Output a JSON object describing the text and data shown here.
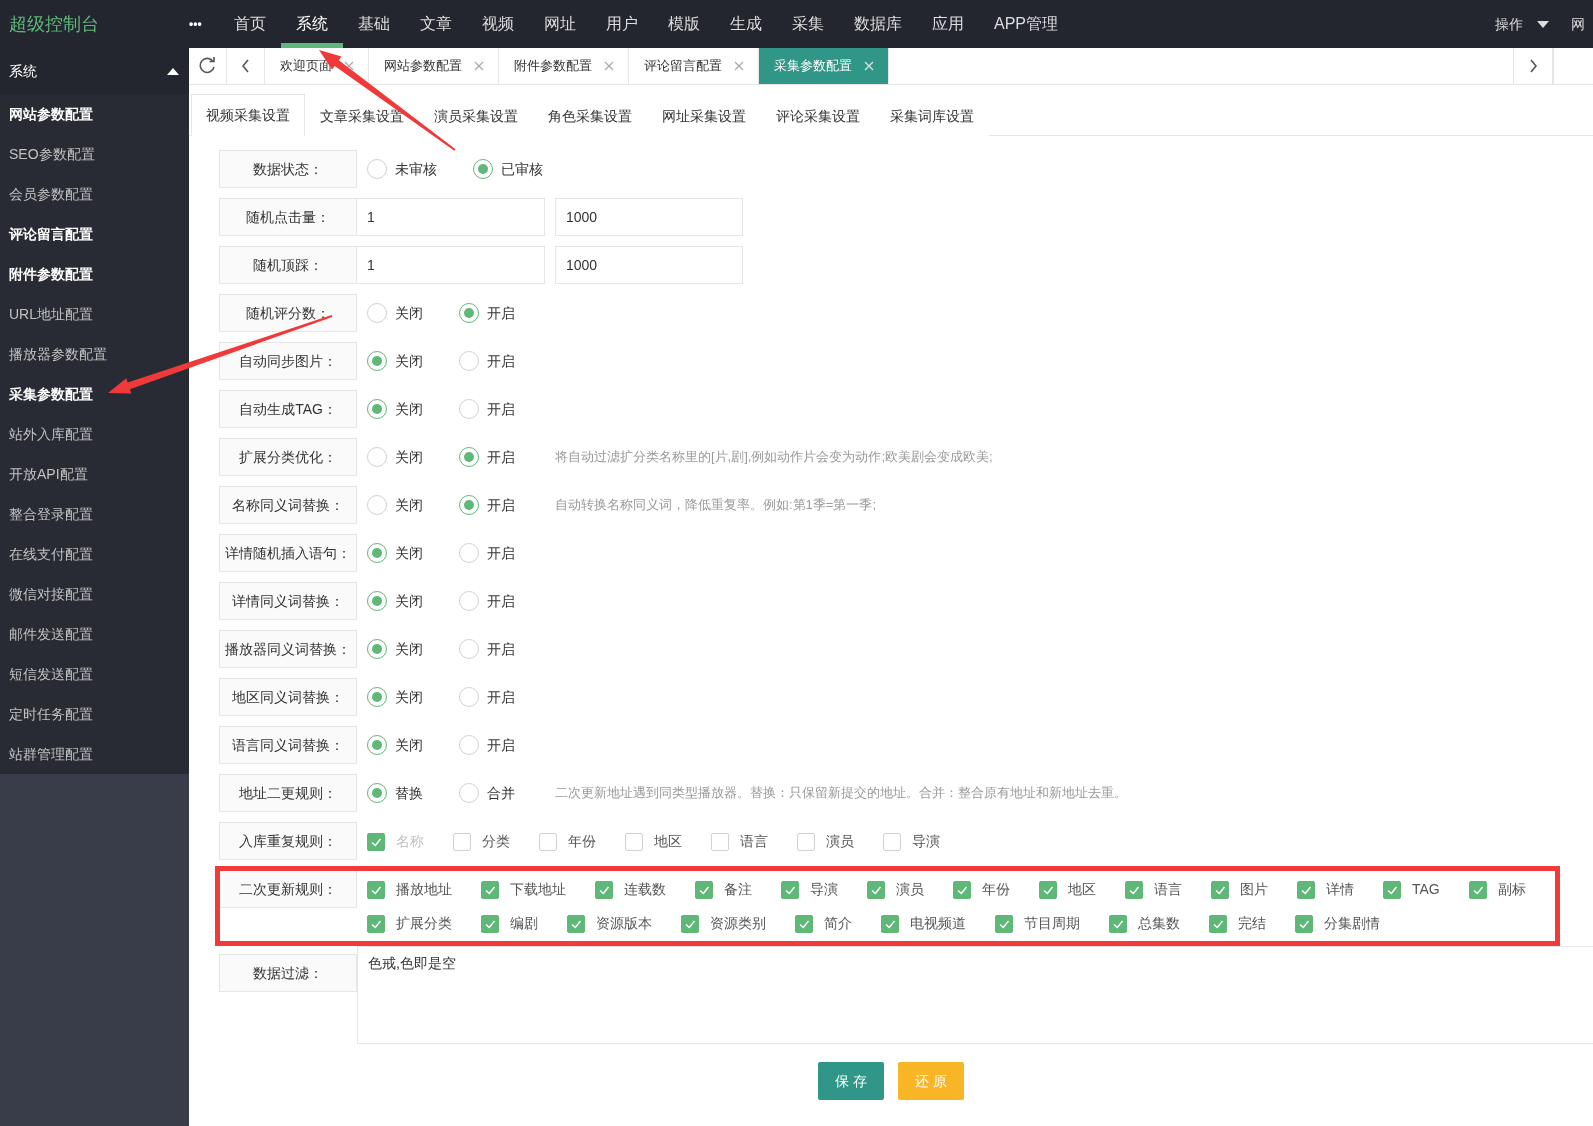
{
  "brand": "超级控制台",
  "more": "•••",
  "nav": [
    {
      "label": "首页",
      "selected": false,
      "pointed": false
    },
    {
      "label": "系统",
      "selected": true,
      "pointed": true
    },
    {
      "label": "基础",
      "selected": false,
      "pointed": false
    },
    {
      "label": "文章",
      "selected": false,
      "pointed": false
    },
    {
      "label": "视频",
      "selected": false,
      "pointed": false
    },
    {
      "label": "网址",
      "selected": false,
      "pointed": false
    },
    {
      "label": "用户",
      "selected": false,
      "pointed": false
    },
    {
      "label": "模版",
      "selected": false,
      "pointed": false
    },
    {
      "label": "生成",
      "selected": false,
      "pointed": false
    },
    {
      "label": "采集",
      "selected": false,
      "pointed": false
    },
    {
      "label": "数据库",
      "selected": false,
      "pointed": false
    },
    {
      "label": "应用",
      "selected": false,
      "pointed": false
    },
    {
      "label": "APP管理",
      "selected": false,
      "pointed": false
    }
  ],
  "nav_right": [
    {
      "label": "操作",
      "kind": "dropdown"
    },
    {
      "label": "网",
      "kind": "link"
    }
  ],
  "sidebar": {
    "title": "系统",
    "expanded": true,
    "items": [
      {
        "label": "网站参数配置",
        "opened": true,
        "pointed": false
      },
      {
        "label": "SEO参数配置",
        "opened": false,
        "pointed": false
      },
      {
        "label": "会员参数配置",
        "opened": false,
        "pointed": false
      },
      {
        "label": "评论留言配置",
        "opened": true,
        "pointed": false
      },
      {
        "label": "附件参数配置",
        "opened": true,
        "pointed": false
      },
      {
        "label": "URL地址配置",
        "opened": false,
        "pointed": false
      },
      {
        "label": "播放器参数配置",
        "opened": false,
        "pointed": false
      },
      {
        "label": "采集参数配置",
        "opened": true,
        "pointed": true
      },
      {
        "label": "站外入库配置",
        "opened": false,
        "pointed": false
      },
      {
        "label": "开放API配置",
        "opened": false,
        "pointed": false
      },
      {
        "label": "整合登录配置",
        "opened": false,
        "pointed": false
      },
      {
        "label": "在线支付配置",
        "opened": false,
        "pointed": false
      },
      {
        "label": "微信对接配置",
        "opened": false,
        "pointed": false
      },
      {
        "label": "邮件发送配置",
        "opened": false,
        "pointed": false
      },
      {
        "label": "短信发送配置",
        "opened": false,
        "pointed": false
      },
      {
        "label": "定时任务配置",
        "opened": false,
        "pointed": false
      },
      {
        "label": "站群管理配置",
        "opened": false,
        "pointed": false
      }
    ]
  },
  "page_tabs": [
    {
      "label": "欢迎页面",
      "selected": false
    },
    {
      "label": "网站参数配置",
      "selected": false
    },
    {
      "label": "附件参数配置",
      "selected": false
    },
    {
      "label": "评论留言配置",
      "selected": false
    },
    {
      "label": "采集参数配置",
      "selected": true
    }
  ],
  "sub_tabs": [
    {
      "label": "视频采集设置",
      "selected": true
    },
    {
      "label": "文章采集设置",
      "selected": false
    },
    {
      "label": "演员采集设置",
      "selected": false
    },
    {
      "label": "角色采集设置",
      "selected": false
    },
    {
      "label": "网址采集设置",
      "selected": false
    },
    {
      "label": "评论采集设置",
      "selected": false
    },
    {
      "label": "采集词库设置",
      "selected": false
    }
  ],
  "form": [
    {
      "kind": "radio",
      "label": "数据状态：",
      "highlighted": false,
      "options": [
        {
          "label": "未审核",
          "selected": false
        },
        {
          "label": "已审核",
          "selected": true
        }
      ]
    },
    {
      "kind": "range",
      "label": "随机点击量：",
      "highlighted": false,
      "values": [
        "1",
        "1000"
      ]
    },
    {
      "kind": "range",
      "label": "随机顶踩：",
      "highlighted": false,
      "values": [
        "1",
        "1000"
      ]
    },
    {
      "kind": "radio",
      "label": "随机评分数：",
      "highlighted": false,
      "options": [
        {
          "label": "关闭",
          "selected": false
        },
        {
          "label": "开启",
          "selected": true
        }
      ]
    },
    {
      "kind": "radio",
      "label": "自动同步图片：",
      "highlighted": false,
      "options": [
        {
          "label": "关闭",
          "selected": true
        },
        {
          "label": "开启",
          "selected": false
        }
      ]
    },
    {
      "kind": "radio",
      "label": "自动生成TAG：",
      "highlighted": false,
      "options": [
        {
          "label": "关闭",
          "selected": true
        },
        {
          "label": "开启",
          "selected": false
        }
      ]
    },
    {
      "kind": "radio",
      "label": "扩展分类优化：",
      "highlighted": false,
      "options": [
        {
          "label": "关闭",
          "selected": false
        },
        {
          "label": "开启",
          "selected": true
        }
      ],
      "hint": "将自动过滤扩分类名称里的[片,剧],例如动作片会变为动作;欧美剧会变成欧美;"
    },
    {
      "kind": "radio",
      "label": "名称同义词替换：",
      "highlighted": false,
      "options": [
        {
          "label": "关闭",
          "selected": false
        },
        {
          "label": "开启",
          "selected": true
        }
      ],
      "hint": "自动转换名称同义词，降低重复率。例如:第1季=第一季;"
    },
    {
      "kind": "radio",
      "label": "详情随机插入语句：",
      "highlighted": false,
      "options": [
        {
          "label": "关闭",
          "selected": true
        },
        {
          "label": "开启",
          "selected": false
        }
      ]
    },
    {
      "kind": "radio",
      "label": "详情同义词替换：",
      "highlighted": false,
      "options": [
        {
          "label": "关闭",
          "selected": true
        },
        {
          "label": "开启",
          "selected": false
        }
      ]
    },
    {
      "kind": "radio",
      "label": "播放器同义词替换：",
      "highlighted": false,
      "options": [
        {
          "label": "关闭",
          "selected": true
        },
        {
          "label": "开启",
          "selected": false
        }
      ]
    },
    {
      "kind": "radio",
      "label": "地区同义词替换：",
      "highlighted": false,
      "options": [
        {
          "label": "关闭",
          "selected": true
        },
        {
          "label": "开启",
          "selected": false
        }
      ]
    },
    {
      "kind": "radio",
      "label": "语言同义词替换：",
      "highlighted": false,
      "options": [
        {
          "label": "关闭",
          "selected": true
        },
        {
          "label": "开启",
          "selected": false
        }
      ]
    },
    {
      "kind": "radio",
      "label": "地址二更规则：",
      "highlighted": false,
      "options": [
        {
          "label": "替换",
          "selected": true
        },
        {
          "label": "合并",
          "selected": false
        }
      ],
      "hint": "二次更新地址遇到同类型播放器。替换：只保留新提交的地址。合并：整合原有地址和新地址去重。"
    },
    {
      "kind": "checks",
      "label": "入库重复规则：",
      "highlighted": false,
      "options": [
        {
          "label": "名称",
          "checked": true,
          "disabled": true
        },
        {
          "label": "分类",
          "checked": false,
          "disabled": false
        },
        {
          "label": "年份",
          "checked": false,
          "disabled": false
        },
        {
          "label": "地区",
          "checked": false,
          "disabled": false
        },
        {
          "label": "语言",
          "checked": false,
          "disabled": false
        },
        {
          "label": "演员",
          "checked": false,
          "disabled": false
        },
        {
          "label": "导演",
          "checked": false,
          "disabled": false
        }
      ]
    },
    {
      "kind": "checks",
      "label": "二次更新规则：",
      "highlighted": true,
      "options": [
        {
          "label": "播放地址",
          "checked": true,
          "disabled": false
        },
        {
          "label": "下载地址",
          "checked": true,
          "disabled": false
        },
        {
          "label": "连载数",
          "checked": true,
          "disabled": false
        },
        {
          "label": "备注",
          "checked": true,
          "disabled": false
        },
        {
          "label": "导演",
          "checked": true,
          "disabled": false
        },
        {
          "label": "演员",
          "checked": true,
          "disabled": false
        },
        {
          "label": "年份",
          "checked": true,
          "disabled": false
        },
        {
          "label": "地区",
          "checked": true,
          "disabled": false
        },
        {
          "label": "语言",
          "checked": true,
          "disabled": false
        },
        {
          "label": "图片",
          "checked": true,
          "disabled": false
        },
        {
          "label": "详情",
          "checked": true,
          "disabled": false
        },
        {
          "label": "TAG",
          "checked": true,
          "disabled": false
        },
        {
          "label": "副标",
          "checked": true,
          "disabled": false
        },
        {
          "label": "扩展分类",
          "checked": true,
          "disabled": false
        },
        {
          "label": "编剧",
          "checked": true,
          "disabled": false
        },
        {
          "label": "资源版本",
          "checked": true,
          "disabled": false
        },
        {
          "label": "资源类别",
          "checked": true,
          "disabled": false
        },
        {
          "label": "简介",
          "checked": true,
          "disabled": false
        },
        {
          "label": "电视频道",
          "checked": true,
          "disabled": false
        },
        {
          "label": "节目周期",
          "checked": true,
          "disabled": false
        },
        {
          "label": "总集数",
          "checked": true,
          "disabled": false
        },
        {
          "label": "完结",
          "checked": true,
          "disabled": false
        },
        {
          "label": "分集剧情",
          "checked": true,
          "disabled": false
        }
      ]
    },
    {
      "kind": "textarea",
      "label": "数据过滤：",
      "highlighted": false,
      "value": "色戒,色即是空"
    }
  ],
  "buttons": [
    {
      "label": "保 存",
      "kind": "primary"
    },
    {
      "label": "还 原",
      "kind": "warm"
    }
  ]
}
